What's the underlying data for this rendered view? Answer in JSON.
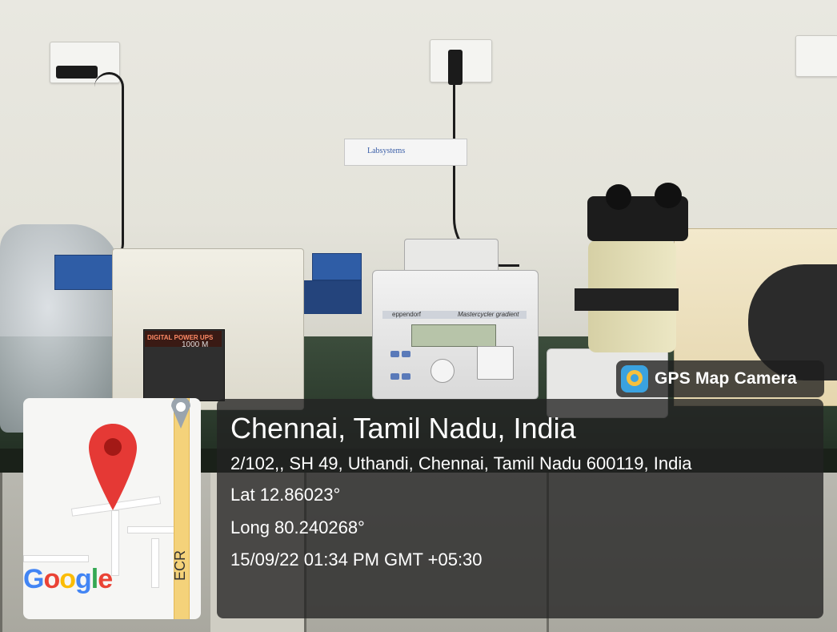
{
  "photo": {
    "ups_label": "DIGITAL POWER UPS",
    "ups_rating": "1000 M",
    "cycler_brand": "eppendorf",
    "cycler_model": "Mastercycler gradient",
    "strip_label": "Labsystems"
  },
  "overlay": {
    "badge": {
      "icon": "gps-map-camera-icon",
      "label": "GPS Map Camera"
    },
    "location": {
      "title": "Chennai, Tamil Nadu, India",
      "address": "2/102,, SH 49, Uthandi, Chennai, Tamil Nadu 600119, India",
      "lat": "Lat 12.86023°",
      "long": "Long 80.240268°",
      "datetime": "15/09/22 01:34 PM GMT +05:30"
    },
    "map": {
      "road_label": "ECR",
      "brand": "Google",
      "pin_icon": "map-pin-icon",
      "pin_color": "#e53935"
    }
  }
}
